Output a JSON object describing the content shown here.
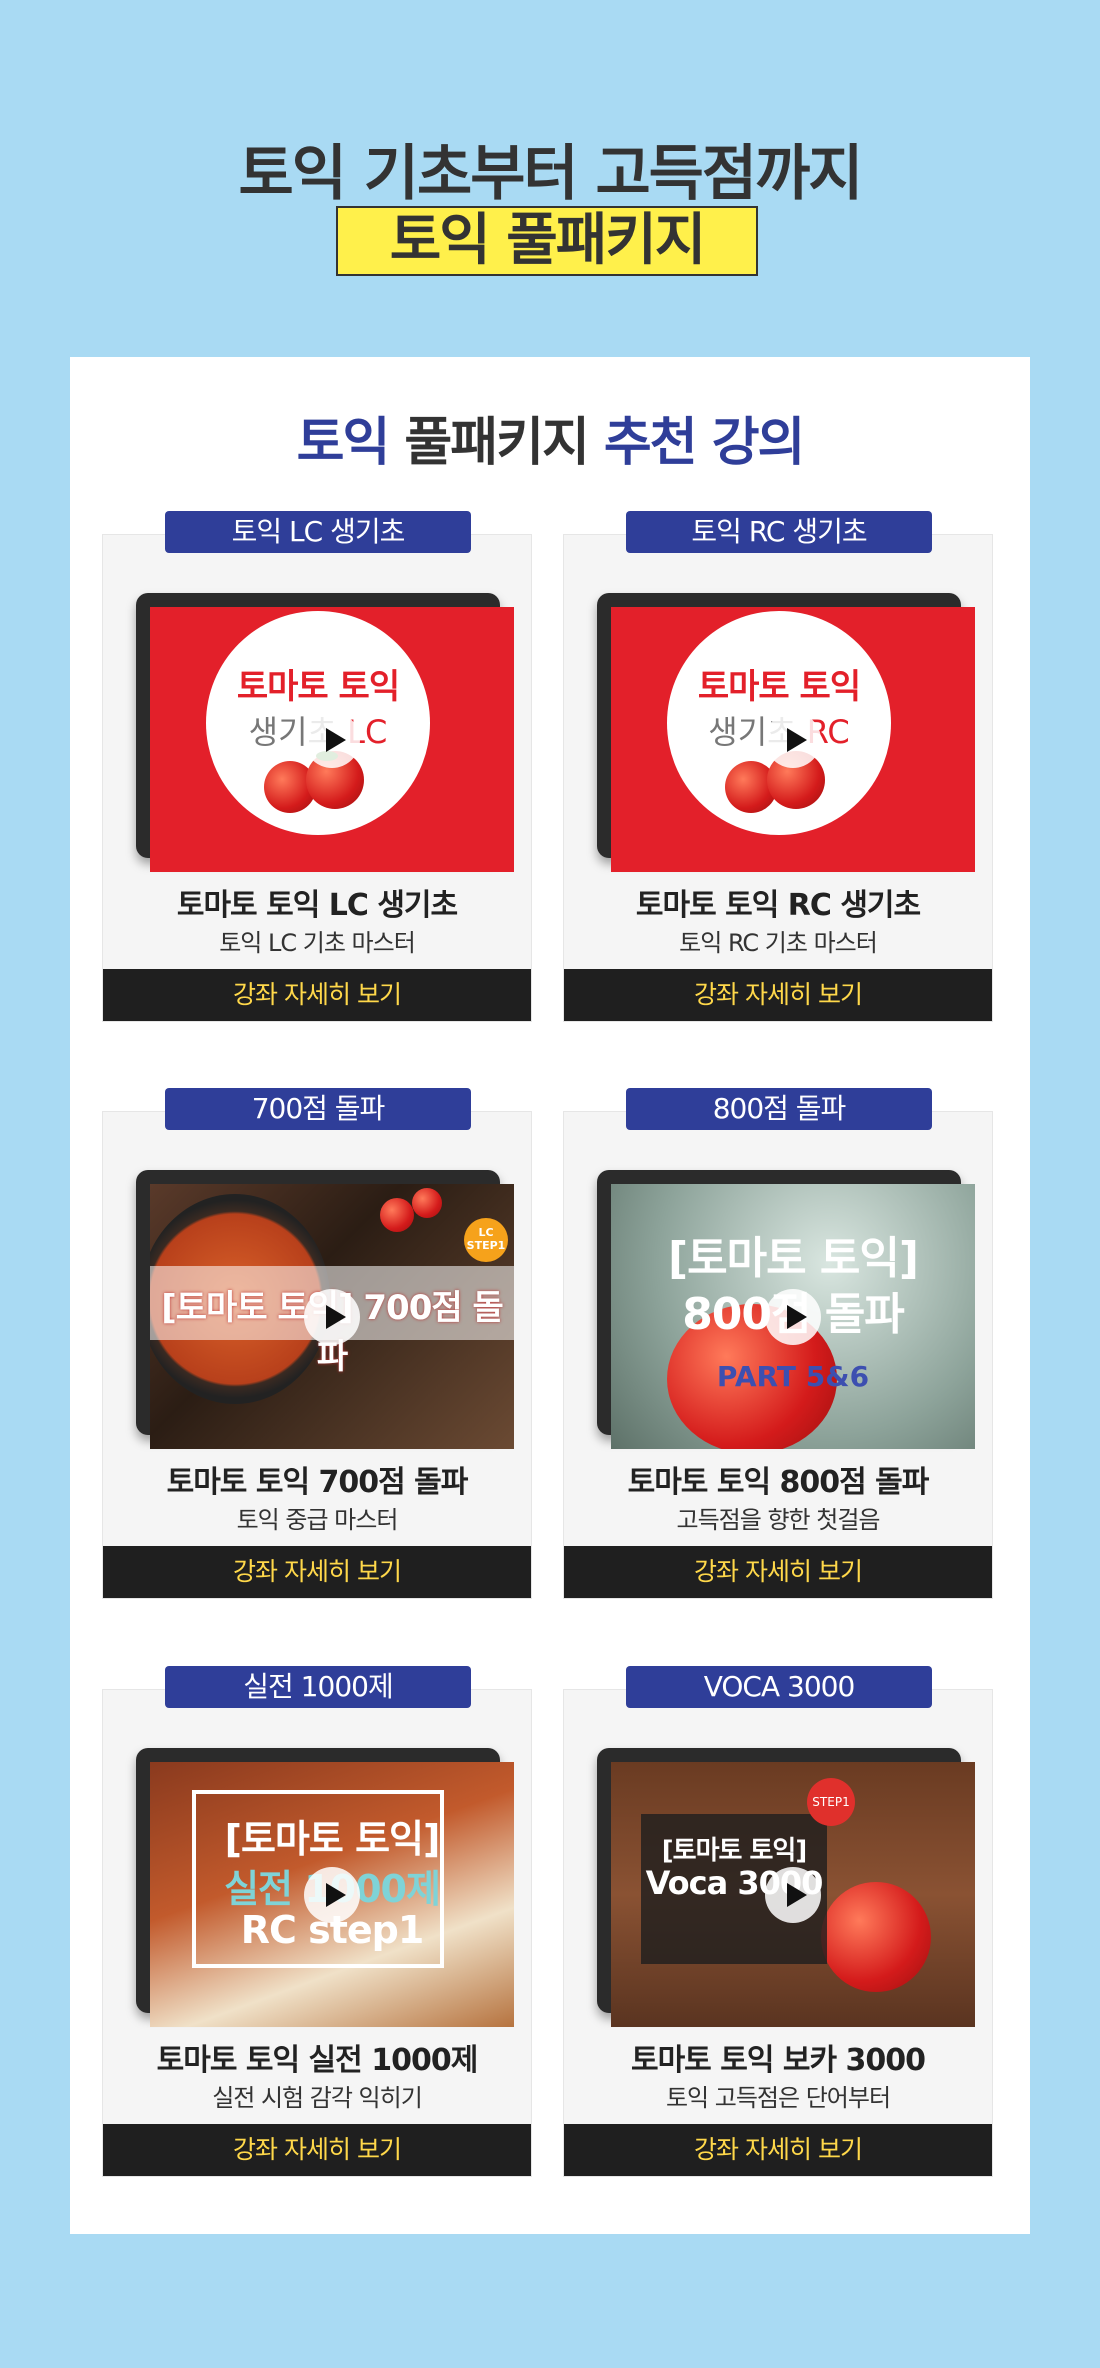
{
  "header": {
    "title": "토익 기초부터 고득점까지",
    "highlight": "토익 풀패키지"
  },
  "section": {
    "title_blue": "토익",
    "title_dark": "풀패키지",
    "title_highlight": "추천 강의"
  },
  "courses": [
    {
      "tag": "토익 LC 생기초",
      "title": "토마토 토익 LC 생기초",
      "subtitle": "토익 LC 기초 마스터",
      "button": "강좌 자세히 보기",
      "thumb": {
        "line1": "토마토 토익",
        "line2a": "생기초",
        "line2b": "LC"
      }
    },
    {
      "tag": "토익 RC 생기초",
      "title": "토마토 토익 RC 생기초",
      "subtitle": "토익 RC 기초 마스터",
      "button": "강좌 자세히 보기",
      "thumb": {
        "line1": "토마토 토익",
        "line2a": "생기초",
        "line2b": "RC"
      }
    },
    {
      "tag": "700점 돌파",
      "title": "토마토 토익 700점 돌파",
      "subtitle": "토익 중급 마스터",
      "button": "강좌 자세히 보기",
      "thumb": {
        "line1": "[토마토 토익] 700점 돌파",
        "badge": "LC STEP1"
      }
    },
    {
      "tag": "800점 돌파",
      "title": "토마토 토익 800점 돌파",
      "subtitle": "고득점을 향한 첫걸음",
      "button": "강좌 자세히 보기",
      "thumb": {
        "line1": "[토마토 토익]",
        "line2": "800점 돌파",
        "line3": "PART 5&6"
      }
    },
    {
      "tag": "실전 1000제",
      "title": "토마토 토익 실전 1000제",
      "subtitle": "실전 시험 감각 익히기",
      "button": "강좌 자세히 보기",
      "thumb": {
        "line1": "[토마토 토익]",
        "line2": "실전 1000제",
        "line3": "RC step1"
      }
    },
    {
      "tag": "VOCA 3000",
      "title": "토마토 토익 보카 3000",
      "subtitle": "토익 고득점은 단어부터",
      "button": "강좌 자세히 보기",
      "thumb": {
        "line1": "[토마토 토익]",
        "line2": "Voca 3000",
        "badge": "STEP1"
      }
    }
  ],
  "colors": {
    "background": "#a9daf3",
    "brand_blue": "#2f3e99",
    "highlight_yellow": "#fff04b",
    "button_text": "#ffd84a"
  }
}
